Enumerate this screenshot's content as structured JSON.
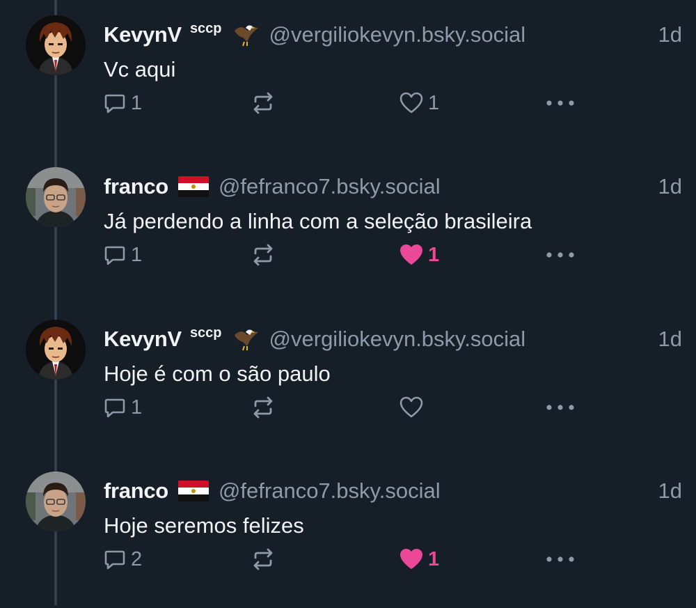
{
  "thread": {
    "posts": [
      {
        "author": "KevynV",
        "superscript": "sccp",
        "badge_icon": "eagle-emoji",
        "handle": "@vergiliokevyn.bsky.social",
        "time": "1d",
        "text": "Vc aqui",
        "avatar_icon": "cartoon-avatar",
        "reply_count": "1",
        "repost_count": "",
        "like_count": "1",
        "liked": false
      },
      {
        "author": "franco",
        "superscript": "",
        "badge_icon": "egypt-flag-emoji",
        "handle": "@fefranco7.bsky.social",
        "time": "1d",
        "text": "Já perdendo a linha com a seleção brasileira",
        "avatar_icon": "photo-avatar",
        "reply_count": "1",
        "repost_count": "",
        "like_count": "1",
        "liked": true
      },
      {
        "author": "KevynV",
        "superscript": "sccp",
        "badge_icon": "eagle-emoji",
        "handle": "@vergiliokevyn.bsky.social",
        "time": "1d",
        "text": "Hoje é com o são paulo",
        "avatar_icon": "cartoon-avatar",
        "reply_count": "1",
        "repost_count": "",
        "like_count": "",
        "liked": false
      },
      {
        "author": "franco",
        "superscript": "",
        "badge_icon": "egypt-flag-emoji",
        "handle": "@fefranco7.bsky.social",
        "time": "1d",
        "text": "Hoje seremos felizes",
        "avatar_icon": "photo-avatar",
        "reply_count": "2",
        "repost_count": "",
        "like_count": "1",
        "liked": true
      }
    ]
  },
  "colors": {
    "background": "#161e27",
    "thread_line": "#2e4052",
    "text_primary": "#f1f3f5",
    "text_secondary": "#8d9aa8",
    "like_active": "#ec4899"
  }
}
